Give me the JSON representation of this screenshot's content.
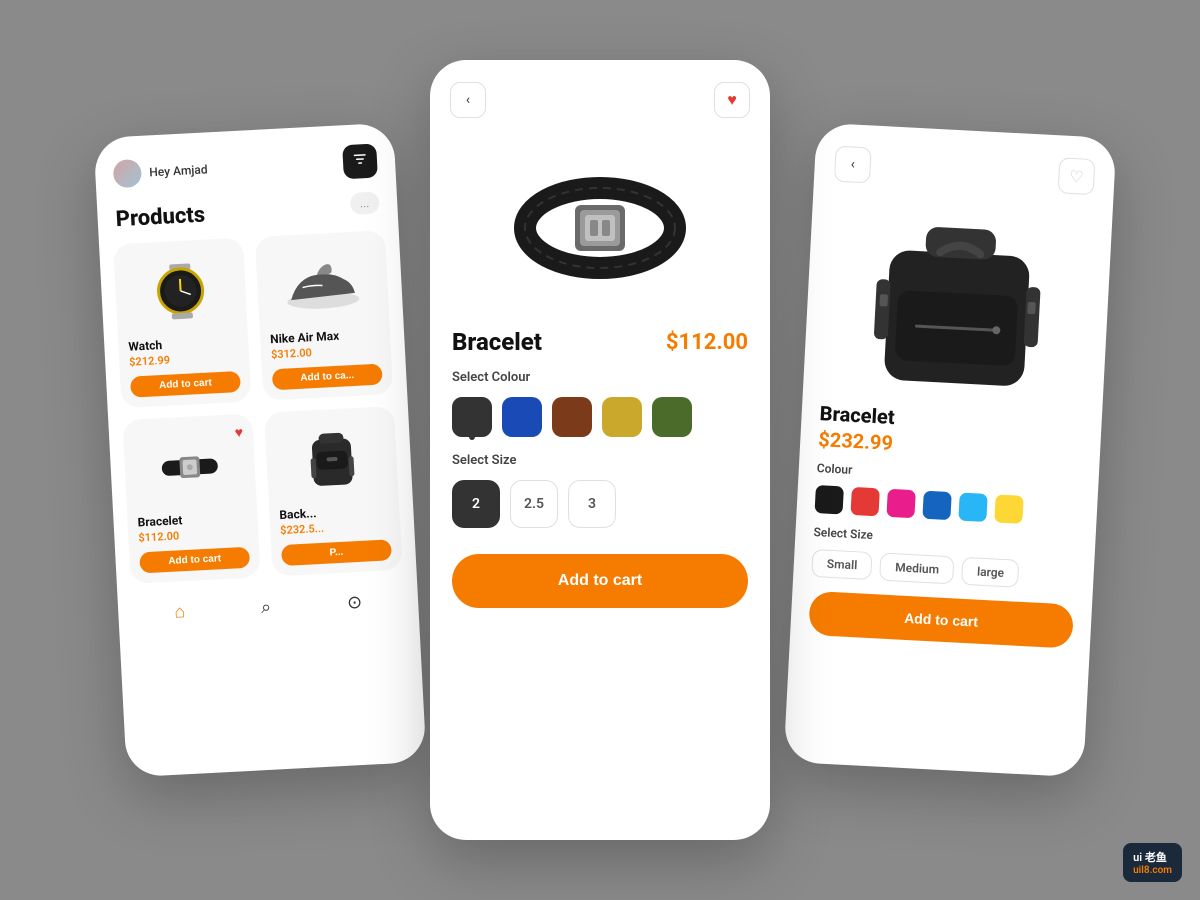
{
  "app": {
    "background": "#8a8a8a",
    "watermark": "ui 老鱼",
    "watermark_sub": "uil8.com"
  },
  "left_phone": {
    "user_greeting": "Hey Amjad",
    "filter_icon": "⊞",
    "dots": "...",
    "products_title": "Products",
    "products": [
      {
        "name": "Watch",
        "price": "$212.99",
        "type": "watch",
        "heart": false,
        "add_to_cart": "Add to cart"
      },
      {
        "name": "Nike Air Max",
        "price": "$312.00",
        "type": "shoe",
        "heart": false,
        "add_to_cart": "Add to ca..."
      },
      {
        "name": "Bracelet",
        "price": "$112.00",
        "type": "bracelet",
        "heart": true,
        "add_to_cart": "Add to cart"
      },
      {
        "name": "Back...",
        "price": "$232.5...",
        "type": "backpack",
        "heart": false,
        "add_to_cart": "P..."
      }
    ],
    "nav": {
      "home_icon": "⌂",
      "search_icon": "⌕",
      "cart_icon": "⊙"
    }
  },
  "center_phone": {
    "product_name": "Bracelet",
    "product_price": "$112.00",
    "back_label": "<",
    "color_section_label": "Select Colour",
    "colors": [
      "#333333",
      "#1a4ab5",
      "#7b3b1a",
      "#c9a82c",
      "#4a6b2a"
    ],
    "selected_color_index": 0,
    "size_section_label": "Select Size",
    "sizes": [
      "2",
      "2.5",
      "3"
    ],
    "selected_size_index": 0,
    "add_to_cart": "Add to cart"
  },
  "right_phone": {
    "product_name": "acelet",
    "product_full_name": "Bracelet",
    "product_price": "$232.99",
    "back_label": "<",
    "color_section_label": "Colour",
    "colors": [
      "#1a1a1a",
      "#e53935",
      "#e91e8c",
      "#1565c0",
      "#29b6f6",
      "#fdd835"
    ],
    "size_section_label": "Select Size",
    "sizes": [
      "Small",
      "Medium",
      "large"
    ],
    "add_to_cart": "Add to cart"
  }
}
